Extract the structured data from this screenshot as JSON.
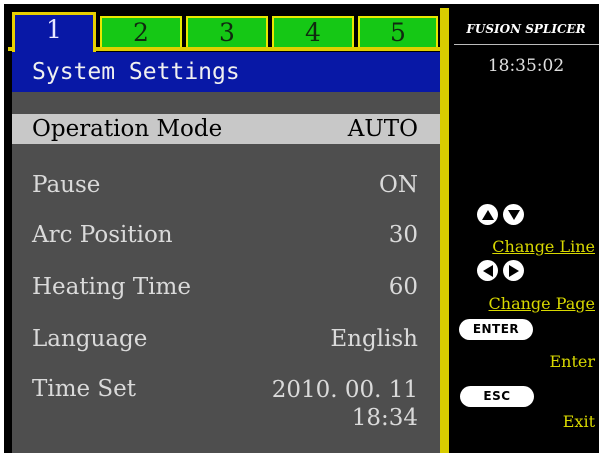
{
  "tabs": [
    {
      "label": "1",
      "active": true
    },
    {
      "label": "2",
      "active": false
    },
    {
      "label": "3",
      "active": false
    },
    {
      "label": "4",
      "active": false
    },
    {
      "label": "5",
      "active": false
    }
  ],
  "title": "System Settings",
  "settings": [
    {
      "label": "Operation Mode",
      "value": "AUTO",
      "selected": true
    },
    {
      "label": "Pause",
      "value": "ON"
    },
    {
      "label": "Arc Position",
      "value": "30"
    },
    {
      "label": "Heating Time",
      "value": "60"
    },
    {
      "label": "Language",
      "value": "English"
    },
    {
      "label": "Time Set",
      "value_line1": "2010. 00. 11",
      "value_line2": "18:34"
    }
  ],
  "sidebar": {
    "brand": "FUSION SPLICER",
    "clock": "18:35:02",
    "help": [
      {
        "icons": [
          "up-arrow-icon",
          "down-arrow-icon"
        ],
        "label": "Change Line"
      },
      {
        "icons": [
          "left-arrow-icon",
          "right-arrow-icon"
        ],
        "label": "Change Page"
      },
      {
        "key": "ENTER",
        "label": "Enter"
      },
      {
        "key": "ESC",
        "label": "Exit"
      }
    ]
  },
  "colors": {
    "background": "#000000",
    "tab_active": "#0818a6",
    "tab_inactive": "#15c815",
    "accent_yellow": "#e0d000",
    "panel": "#4e4e4e",
    "selected_row": "#c8c8c8",
    "help_text": "#d8d800"
  }
}
